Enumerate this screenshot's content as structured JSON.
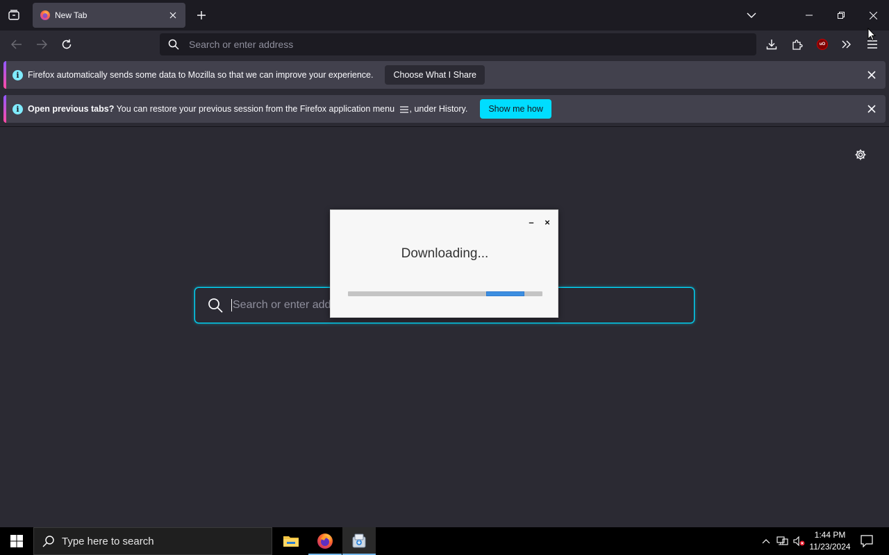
{
  "browser": {
    "tab": {
      "title": "New Tab",
      "favicon": "firefox-logo"
    },
    "urlbar": {
      "placeholder": "Search or enter address"
    },
    "icons": {
      "tab_overview": "firefox-view-icon",
      "new_tab": "plus-icon",
      "list_tabs": "chevron-down-icon",
      "back": "back-arrow-icon",
      "forward": "forward-arrow-icon",
      "reload": "reload-icon",
      "downloads": "download-icon",
      "extensions": "puzzle-icon",
      "ublock": "ublock-origin-icon",
      "overflow": "double-chevron-icon",
      "menu": "hamburger-icon"
    }
  },
  "notifications": [
    {
      "message": "Firefox automatically sends some data to Mozilla so that we can improve your experience.",
      "button": "Choose What I Share"
    },
    {
      "bold": "Open previous tabs?",
      "message_before_icon": " You can restore your previous session from the Firefox application menu ",
      "message_after_icon": ", under History.",
      "button": "Show me how"
    }
  ],
  "newtab": {
    "search_placeholder": "Search or enter address"
  },
  "download_dialog": {
    "title": "Downloading...",
    "minimize": "–",
    "close": "×",
    "progress_fraction": 0.2
  },
  "taskbar": {
    "search_placeholder": "Type here to search",
    "apps": [
      "file-explorer",
      "firefox",
      "installer"
    ],
    "clock": {
      "time": "1:44 PM",
      "date": "11/23/2024"
    }
  },
  "colors": {
    "accent": "#00ddff",
    "chrome_dark": "#1c1b22",
    "content_bg": "#2b2a33",
    "progress": "#3d8fe0"
  }
}
